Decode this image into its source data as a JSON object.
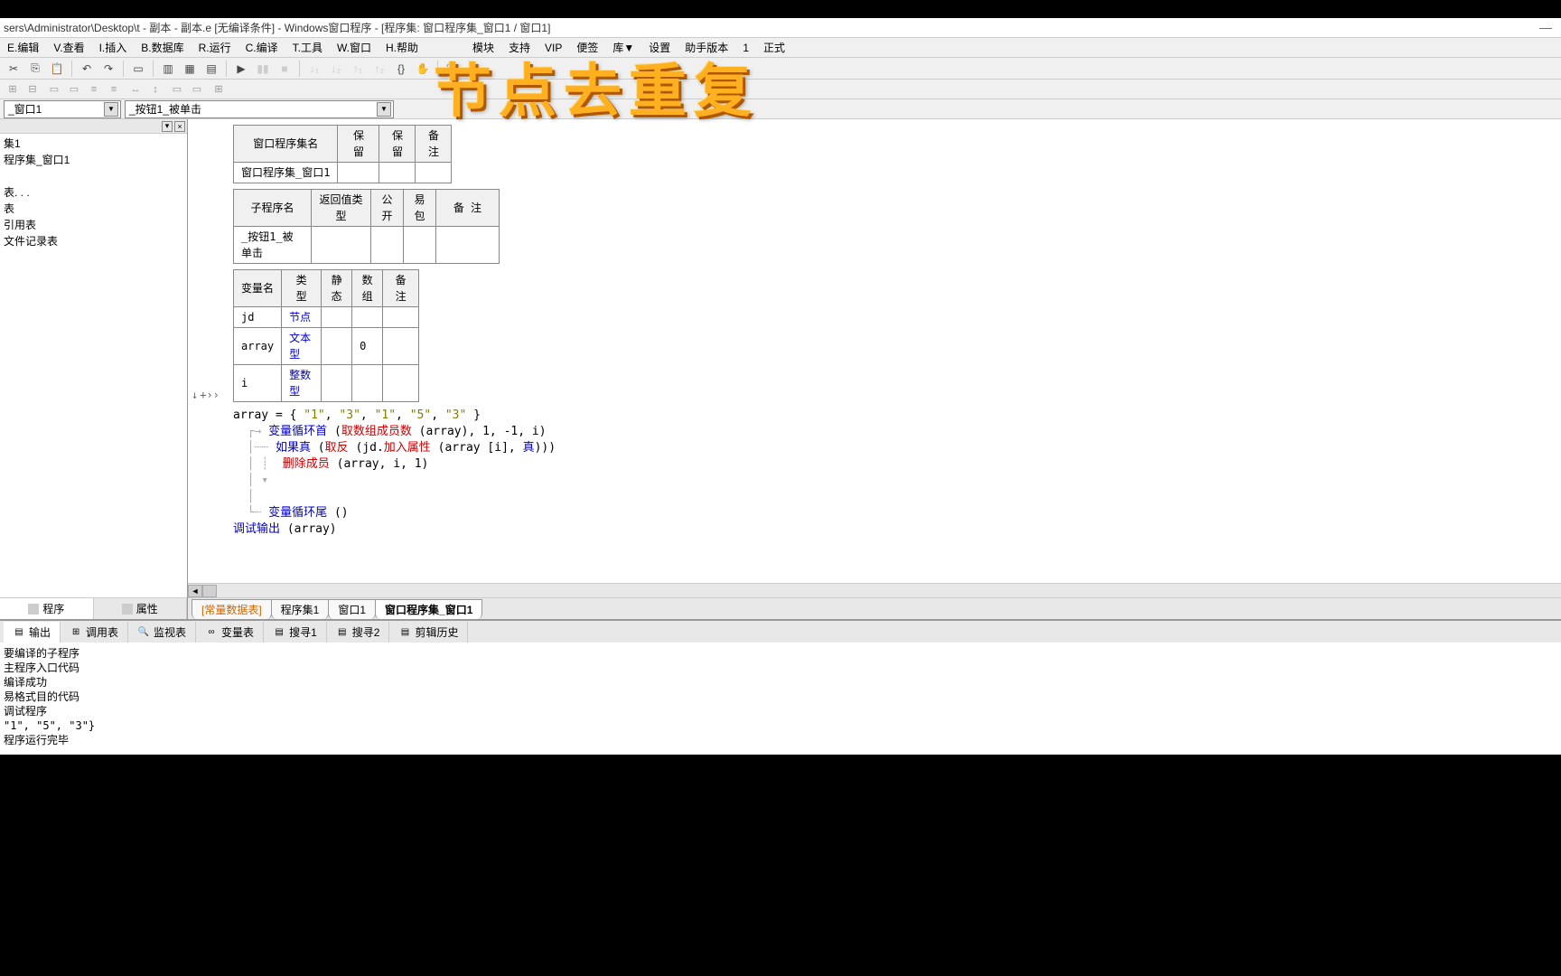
{
  "title": "sers\\Administrator\\Desktop\\t - 副本 - 副本.e [无编译条件] - Windows窗口程序 - [程序集: 窗口程序集_窗口1 / 窗口1]",
  "overlay": "节点去重复",
  "menu": [
    "E.编辑",
    "V.查看",
    "I.插入",
    "B.数据库",
    "R.运行",
    "C.编译",
    "T.工具",
    "W.窗口",
    "H.帮助",
    "模块",
    "支持",
    "VIP",
    "便签",
    "库▼",
    "设置",
    "助手版本",
    "1",
    "正式"
  ],
  "dropdowns": {
    "left": "_窗口1",
    "right": "_按钮1_被单击"
  },
  "tree": {
    "items": [
      "",
      "集1",
      "程序集_窗口1",
      "",
      "表. . .",
      "表",
      "引用表",
      "文件记录表"
    ]
  },
  "sidebar_tabs": {
    "program": "程序",
    "props": "属性"
  },
  "table1": {
    "headers": [
      "窗口程序集名",
      "保 留",
      "保 留",
      "备 注"
    ],
    "row": [
      "窗口程序集_窗口1",
      "",
      "",
      ""
    ]
  },
  "table2": {
    "headers": [
      "子程序名",
      "返回值类型",
      "公开",
      "易包",
      "备 注"
    ],
    "row": [
      "_按钮1_被单击",
      "",
      "",
      "",
      ""
    ]
  },
  "table3": {
    "headers": [
      "变量名",
      "类 型",
      "静态",
      "数组",
      "备 注"
    ],
    "rows": [
      [
        "jd",
        "节点",
        "",
        "",
        ""
      ],
      [
        "array",
        "文本型",
        "",
        "0",
        ""
      ],
      [
        "i",
        "整数型",
        "",
        "",
        ""
      ]
    ]
  },
  "code": {
    "l1a": "array = { ",
    "l1b": "\"1\"",
    "l1c": ", ",
    "l1d": "\"3\"",
    "l1e": ", ",
    "l1f": "\"1\"",
    "l1g": ", ",
    "l1h": "\"5\"",
    "l1i": ", ",
    "l1j": "\"3\"",
    "l1k": " }",
    "l2a": "变量循环首",
    "l2b": " (",
    "l2c": "取数组成员数",
    "l2d": " (array), 1, -1, i)",
    "l3a": "如果真",
    "l3b": " (",
    "l3c": "取反",
    "l3d": " (jd.",
    "l3e": "加入属性",
    "l3f": " (array [i], ",
    "l3g": "真",
    "l3h": ")))",
    "l4a": "删除成员",
    "l4b": " (array, i, 1)",
    "l5": "",
    "l6a": "变量循环尾",
    "l6b": " ()",
    "l7a": "调试输出",
    "l7b": " (array)"
  },
  "editor_tabs": [
    "[常量数据表]",
    "程序集1",
    "窗口1",
    "窗口程序集_窗口1"
  ],
  "bottom_tabs": [
    "输出",
    "调用表",
    "监视表",
    "变量表",
    "搜寻1",
    "搜寻2",
    "剪辑历史"
  ],
  "output_lines": [
    "要编译的子程序",
    "",
    "主程序入口代码",
    "编译成功",
    "易格式目的代码",
    "调试程序",
    "\"1\", \"5\", \"3\"}",
    "程序运行完毕"
  ],
  "gutter_markers": {
    "down": "↓",
    "plus": "+››"
  }
}
